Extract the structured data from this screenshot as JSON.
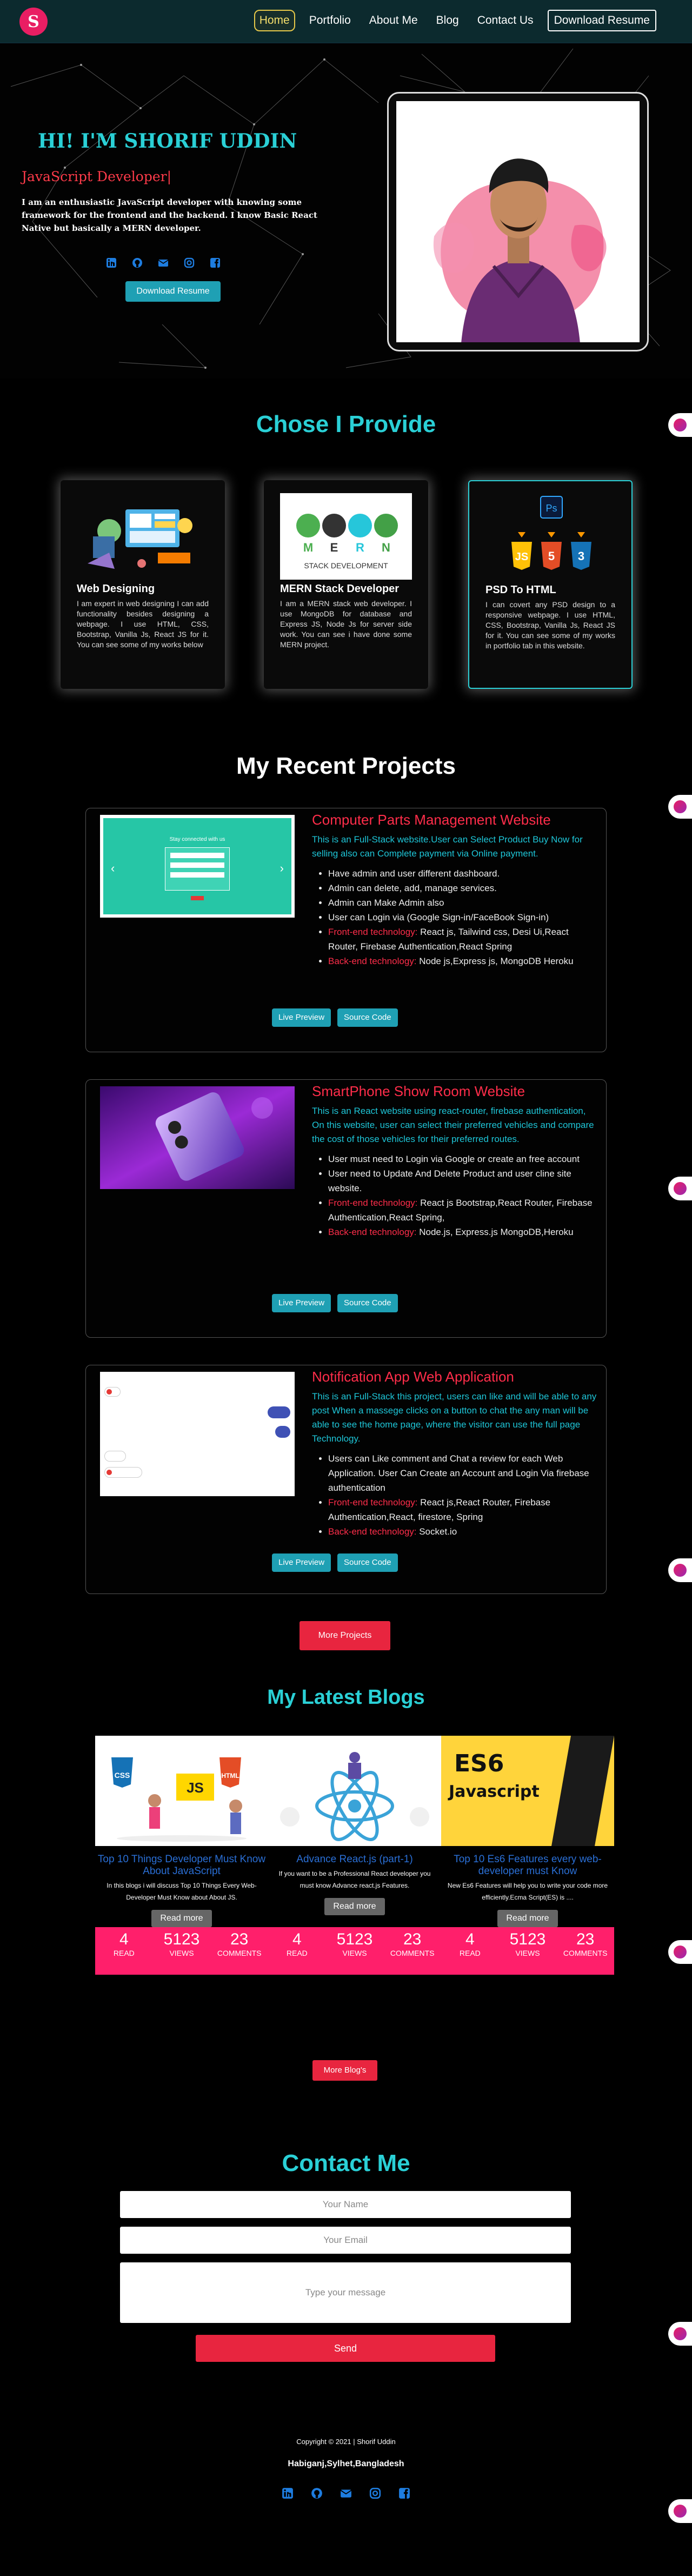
{
  "nav": {
    "logo": "S",
    "links": [
      {
        "label": "Home"
      },
      {
        "label": "Portfolio"
      },
      {
        "label": "About Me"
      },
      {
        "label": "Blog"
      },
      {
        "label": "Contact Us"
      }
    ],
    "download_label": "Download Resume"
  },
  "hero": {
    "title": "HI! I'M SHORIF UDDIN",
    "subtitle": "JavaScript Developer|",
    "description": "I am an enthusiastic JavaScript developer with knowing some framework for the frontend and the backend. I know Basic React Native but basically a MERN developer.",
    "social_icons": [
      "linkedin-icon",
      "github-icon",
      "email-icon",
      "instagram-icon",
      "facebook-icon"
    ],
    "download_label": "Download Resume"
  },
  "services": {
    "title": "Chose I Provide",
    "items": [
      {
        "title": "Web Designing",
        "text": "I am expert in web designing I can add functionality besides designing a webpage. I use HTML, CSS, Bootstrap, Vanilla Js, React JS for it. You can see some of my works below"
      },
      {
        "title": "MERN Stack Developer",
        "image_text": "STACK DEVELOPMENT",
        "text": "I am a MERN stack web developer. I use MongoDB for database and Express JS, Node Js for server side work. You can see i have done some MERN project."
      },
      {
        "title": "PSD To HTML",
        "text": "I can covert any PSD design to a responsive webpage. I use HTML, CSS, Bootstrap, Vanilla Js, React JS for it. You can see some of my works in portfolio tab in this website."
      }
    ]
  },
  "projects": {
    "title": "My Recent Projects",
    "items": [
      {
        "title": "Computer Parts Management Website",
        "lead": "This is an Full-Stack website.User can Select Product Buy Now for selling also can Complete payment via Online payment.",
        "bullets": [
          "Have admin and user different dashboard.",
          "Admin can delete, add, manage services.",
          "Admin can Make Admin also",
          "User can Login via (Google Sign-in/FaceBook Sign-in)"
        ],
        "front_label": "Front-end technology:",
        "front": " React js, Tailwind css, Desi Ui,React Router, Firebase Authentication,React Spring",
        "back_label": "Back-end technology:",
        "back": " Node js,Express js, MongoDB Heroku"
      },
      {
        "title": "SmartPhone Show Room Website",
        "lead": "This is an React website using react-router, firebase authentication, On this website, user can select their preferred vehicles and compare the cost of those vehicles for their preferred routes.",
        "bullets": [
          "User must need to Login via Google or create an free account",
          "User need to Update And Delete Product and user cline site website."
        ],
        "front_label": "Front-end technology:",
        "front": " React js Bootstrap,React Router, Firebase Authentication,React Spring,",
        "back_label": "Back-end technology:",
        "back": " Node.js, Express.js MongoDB,Heroku"
      },
      {
        "title": "Notification App Web Application",
        "lead": "This is an Full-Stack this project, users can like and will be able to any post When a massege clicks on a button to chat the any man will be able to see the home page, where the visitor can use the full page Technology.",
        "bullets": [
          "Users can Like comment and Chat a review for each Web Application. User Can Create an Account and Login Via firebase authentication"
        ],
        "front_label": "Front-end technology:",
        "front": " React js,React Router, Firebase Authentication,React, firestore, Spring",
        "back_label": "Back-end technology:",
        "back": " Socket.io"
      }
    ],
    "preview_label": "Live Preview",
    "source_label": "Source Code",
    "more_label": "More Projects",
    "thumb1_text": "Stay connected with us"
  },
  "blogs": {
    "title": "My Latest Blogs",
    "items": [
      {
        "title": "Top 10 Things Developer Must Know About JavaScript",
        "text": "In this blogs i will discuss Top 10 Things Every Web-Developer Must Know about About JS.",
        "read": "4",
        "views": "5123",
        "comments": "23"
      },
      {
        "title": "Advance React.js (part-1)",
        "text": "If you want to be a Professional React developer you must know Advance react.js Features.",
        "read": "4",
        "views": "5123",
        "comments": "23"
      },
      {
        "title": "Top 10 Es6 Features every web-developer must Know",
        "text": "New Es6 Features will help you to write your code more efficiently.Ecma Script(ES) is ....",
        "read": "4",
        "views": "5123",
        "comments": "23"
      }
    ],
    "read_more": "Read more",
    "read_label": "READ",
    "views_label": "VIEWS",
    "comments_label": "COMMENTS",
    "more_label": "More Blog's",
    "es6_line1": "ES6",
    "es6_line2": "Javascript"
  },
  "contact": {
    "title": "Contact Me",
    "name_placeholder": "Your Name",
    "email_placeholder": "Your Email",
    "message_placeholder": "Type your message",
    "send_label": "Send"
  },
  "footer": {
    "copyright": "Copyright © 2021 | Shorif Uddin",
    "address": "Habiganj,Sylhet,Bangladesh"
  }
}
